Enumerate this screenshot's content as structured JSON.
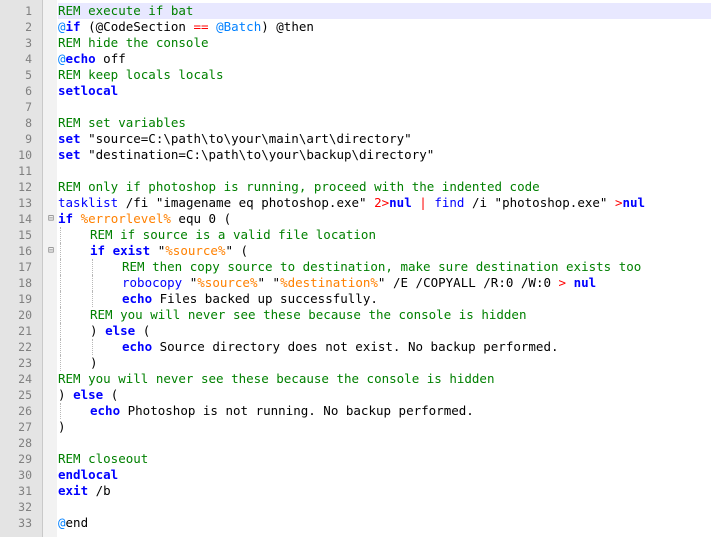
{
  "editor": {
    "current_line": 1,
    "colors": {
      "comment": "#008000",
      "keyword": "#0000ff",
      "string": "#808080",
      "variable": "#ff8000",
      "operator": "#ff0000",
      "label": "#0080ff",
      "gutter": "#e4e4e4"
    },
    "lines": [
      {
        "num": "1",
        "indent": 0,
        "spans": [
          {
            "c": "rem",
            "t": "REM execute if bat"
          }
        ]
      },
      {
        "num": "2",
        "indent": 0,
        "spans": [
          {
            "c": "at",
            "t": "@"
          },
          {
            "c": "kw",
            "t": "if"
          },
          {
            "c": "txt",
            "t": " (@CodeSection "
          },
          {
            "c": "op",
            "t": "=="
          },
          {
            "c": "txt",
            "t": " "
          },
          {
            "c": "at",
            "t": "@Batch"
          },
          {
            "c": "txt",
            "t": ") @then"
          }
        ]
      },
      {
        "num": "3",
        "indent": 0,
        "spans": [
          {
            "c": "rem",
            "t": "REM hide the console"
          }
        ]
      },
      {
        "num": "4",
        "indent": 0,
        "spans": [
          {
            "c": "at",
            "t": "@"
          },
          {
            "c": "kw",
            "t": "echo"
          },
          {
            "c": "txt",
            "t": " off"
          }
        ]
      },
      {
        "num": "5",
        "indent": 0,
        "spans": [
          {
            "c": "rem",
            "t": "REM keep locals locals"
          }
        ]
      },
      {
        "num": "6",
        "indent": 0,
        "spans": [
          {
            "c": "kw",
            "t": "setlocal"
          }
        ]
      },
      {
        "num": "7",
        "indent": 0,
        "spans": []
      },
      {
        "num": "8",
        "indent": 0,
        "spans": [
          {
            "c": "rem",
            "t": "REM set variables"
          }
        ]
      },
      {
        "num": "9",
        "indent": 0,
        "spans": [
          {
            "c": "kw",
            "t": "set"
          },
          {
            "c": "txt",
            "t": " \"source=C:\\path\\to\\your\\main\\art\\directory\""
          }
        ]
      },
      {
        "num": "10",
        "indent": 0,
        "spans": [
          {
            "c": "kw",
            "t": "set"
          },
          {
            "c": "txt",
            "t": " \"destination=C:\\path\\to\\your\\backup\\directory\""
          }
        ]
      },
      {
        "num": "11",
        "indent": 0,
        "spans": []
      },
      {
        "num": "12",
        "indent": 0,
        "spans": [
          {
            "c": "rem",
            "t": "REM only if photoshop is running, proceed with the indented code"
          }
        ]
      },
      {
        "num": "13",
        "indent": 0,
        "spans": [
          {
            "c": "cmd",
            "t": "tasklist"
          },
          {
            "c": "txt",
            "t": " /fi \"imagename eq photoshop.exe\" "
          },
          {
            "c": "op",
            "t": "2>"
          },
          {
            "c": "kw",
            "t": "nul"
          },
          {
            "c": "txt",
            "t": " "
          },
          {
            "c": "op",
            "t": "|"
          },
          {
            "c": "txt",
            "t": " "
          },
          {
            "c": "cmd",
            "t": "find"
          },
          {
            "c": "txt",
            "t": " /i \"photoshop.exe\" "
          },
          {
            "c": "op",
            "t": ">"
          },
          {
            "c": "kw",
            "t": "nul"
          }
        ]
      },
      {
        "num": "14",
        "indent": 0,
        "fold": "minus",
        "spans": [
          {
            "c": "kw",
            "t": "if"
          },
          {
            "c": "txt",
            "t": " "
          },
          {
            "c": "var",
            "t": "%errorlevel%"
          },
          {
            "c": "txt",
            "t": " equ 0 ("
          }
        ]
      },
      {
        "num": "15",
        "indent": 1,
        "spans": [
          {
            "c": "rem",
            "t": "REM if source is a valid file location"
          }
        ]
      },
      {
        "num": "16",
        "indent": 1,
        "fold": "minus",
        "spans": [
          {
            "c": "kw",
            "t": "if exist"
          },
          {
            "c": "txt",
            "t": " \""
          },
          {
            "c": "var",
            "t": "%source%"
          },
          {
            "c": "txt",
            "t": "\" ("
          }
        ]
      },
      {
        "num": "17",
        "indent": 2,
        "spans": [
          {
            "c": "rem",
            "t": "REM then copy source to destination, make sure destination exists too"
          }
        ]
      },
      {
        "num": "18",
        "indent": 2,
        "spans": [
          {
            "c": "cmd",
            "t": "robocopy"
          },
          {
            "c": "txt",
            "t": " \""
          },
          {
            "c": "var",
            "t": "%source%"
          },
          {
            "c": "txt",
            "t": "\" \""
          },
          {
            "c": "var",
            "t": "%destination%"
          },
          {
            "c": "txt",
            "t": "\" /E /COPYALL /R:0 /W:0 "
          },
          {
            "c": "op",
            "t": ">"
          },
          {
            "c": "txt",
            "t": " "
          },
          {
            "c": "kw",
            "t": "nul"
          }
        ]
      },
      {
        "num": "19",
        "indent": 2,
        "spans": [
          {
            "c": "kw",
            "t": "echo"
          },
          {
            "c": "txt",
            "t": " Files backed up successfully."
          }
        ]
      },
      {
        "num": "20",
        "indent": 1,
        "spans": [
          {
            "c": "rem",
            "t": "REM you will never see these because the console is hidden"
          }
        ]
      },
      {
        "num": "21",
        "indent": 1,
        "spans": [
          {
            "c": "txt",
            "t": ") "
          },
          {
            "c": "kw",
            "t": "else"
          },
          {
            "c": "txt",
            "t": " ("
          }
        ]
      },
      {
        "num": "22",
        "indent": 2,
        "spans": [
          {
            "c": "kw",
            "t": "echo"
          },
          {
            "c": "txt",
            "t": " Source directory does not exist. No backup performed."
          }
        ]
      },
      {
        "num": "23",
        "indent": 1,
        "spans": [
          {
            "c": "txt",
            "t": ")"
          }
        ]
      },
      {
        "num": "24",
        "indent": 0,
        "spans": [
          {
            "c": "rem",
            "t": "REM you will never see these because the console is hidden"
          }
        ]
      },
      {
        "num": "25",
        "indent": 0,
        "spans": [
          {
            "c": "txt",
            "t": ") "
          },
          {
            "c": "kw",
            "t": "else"
          },
          {
            "c": "txt",
            "t": " ("
          }
        ]
      },
      {
        "num": "26",
        "indent": 1,
        "spans": [
          {
            "c": "kw",
            "t": "echo"
          },
          {
            "c": "txt",
            "t": " Photoshop is not running. No backup performed."
          }
        ]
      },
      {
        "num": "27",
        "indent": 0,
        "spans": [
          {
            "c": "txt",
            "t": ")"
          }
        ]
      },
      {
        "num": "28",
        "indent": 0,
        "spans": []
      },
      {
        "num": "29",
        "indent": 0,
        "spans": [
          {
            "c": "rem",
            "t": "REM closeout"
          }
        ]
      },
      {
        "num": "30",
        "indent": 0,
        "spans": [
          {
            "c": "kw",
            "t": "endlocal"
          }
        ]
      },
      {
        "num": "31",
        "indent": 0,
        "spans": [
          {
            "c": "kw",
            "t": "exit"
          },
          {
            "c": "txt",
            "t": " /b"
          }
        ]
      },
      {
        "num": "32",
        "indent": 0,
        "spans": []
      },
      {
        "num": "33",
        "indent": 0,
        "spans": [
          {
            "c": "at",
            "t": "@"
          },
          {
            "c": "txt",
            "t": "end"
          }
        ]
      }
    ]
  }
}
